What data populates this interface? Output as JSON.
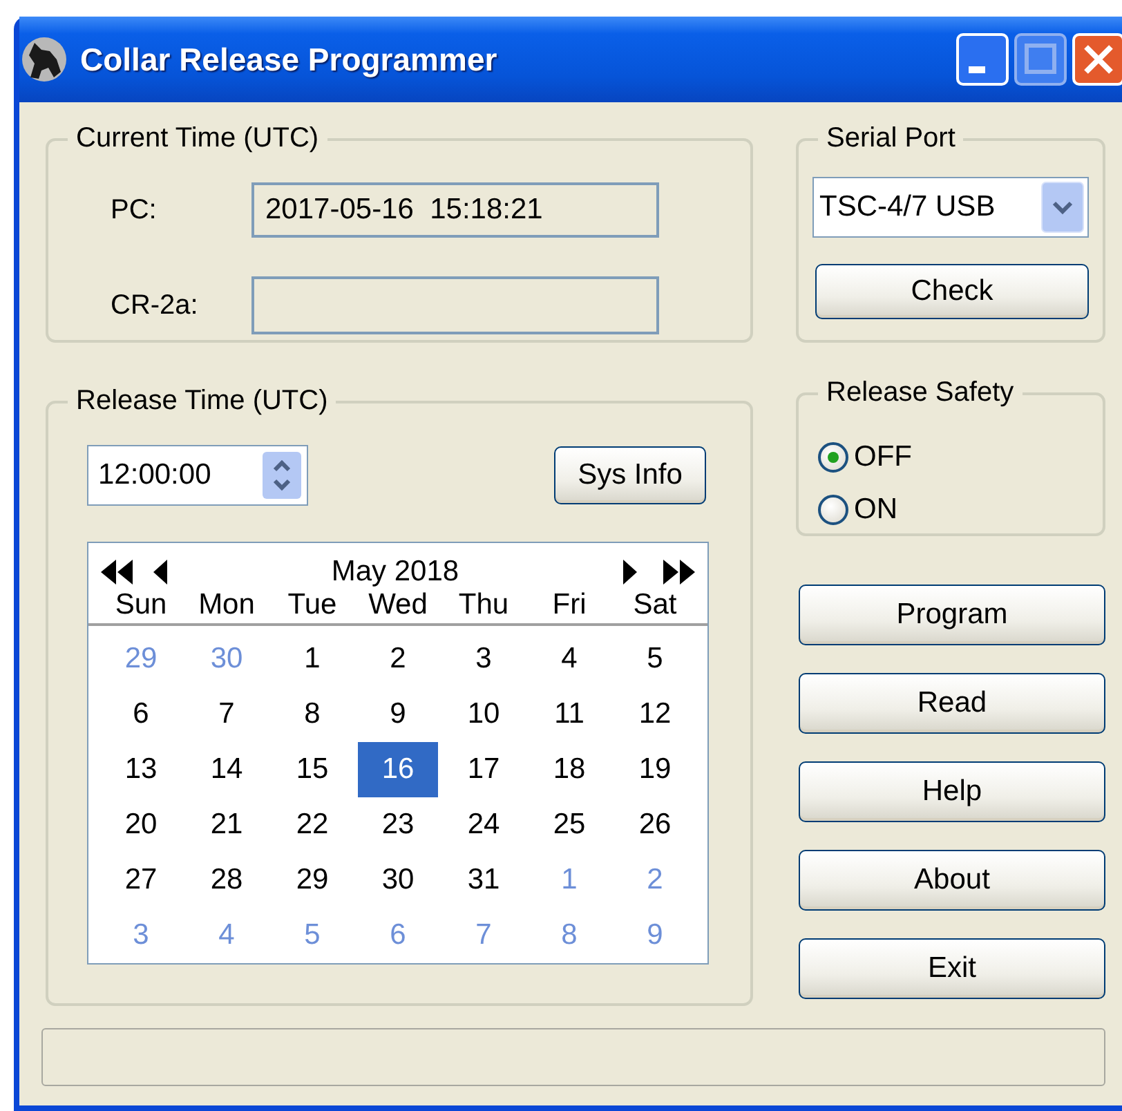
{
  "window": {
    "title": "Collar Release Programmer"
  },
  "current_time": {
    "legend": "Current Time (UTC)",
    "fields": [
      {
        "label": "PC:",
        "value": "2017-05-16  15:18:21"
      },
      {
        "label": "CR-2a:"
      }
    ]
  },
  "serial_port": {
    "legend": "Serial Port",
    "value": "TSC-4/7 USB",
    "button": "Check"
  },
  "release_time": {
    "legend": "Release Time (UTC)",
    "time": "12:00:00",
    "button": "Sys Info",
    "calendar": {
      "month": "May 2018",
      "weekdays": [
        "Sun",
        "Mon",
        "Tue",
        "Wed",
        "Thu",
        "Fri",
        "Sat"
      ],
      "weeks": [
        [
          {
            "day": "29",
            "other_month": true,
            "selected": false
          },
          {
            "day": "30",
            "other_month": true,
            "selected": false
          },
          {
            "day": "1",
            "other_month": false,
            "selected": false
          },
          {
            "day": "2",
            "other_month": false,
            "selected": false
          },
          {
            "day": "3",
            "other_month": false,
            "selected": false
          },
          {
            "day": "4",
            "other_month": false,
            "selected": false
          },
          {
            "day": "5",
            "other_month": false,
            "selected": false
          }
        ],
        [
          {
            "day": "6",
            "other_month": false,
            "selected": false
          },
          {
            "day": "7",
            "other_month": false,
            "selected": false
          },
          {
            "day": "8",
            "other_month": false,
            "selected": false
          },
          {
            "day": "9",
            "other_month": false,
            "selected": false
          },
          {
            "day": "10",
            "other_month": false,
            "selected": false
          },
          {
            "day": "11",
            "other_month": false,
            "selected": false
          },
          {
            "day": "12",
            "other_month": false,
            "selected": false
          }
        ],
        [
          {
            "day": "13",
            "other_month": false,
            "selected": false
          },
          {
            "day": "14",
            "other_month": false,
            "selected": false
          },
          {
            "day": "15",
            "other_month": false,
            "selected": false
          },
          {
            "day": "16",
            "other_month": false,
            "selected": true
          },
          {
            "day": "17",
            "other_month": false,
            "selected": false
          },
          {
            "day": "18",
            "other_month": false,
            "selected": false
          },
          {
            "day": "19",
            "other_month": false,
            "selected": false
          }
        ],
        [
          {
            "day": "20",
            "other_month": false,
            "selected": false
          },
          {
            "day": "21",
            "other_month": false,
            "selected": false
          },
          {
            "day": "22",
            "other_month": false,
            "selected": false
          },
          {
            "day": "23",
            "other_month": false,
            "selected": false
          },
          {
            "day": "24",
            "other_month": false,
            "selected": false
          },
          {
            "day": "25",
            "other_month": false,
            "selected": false
          },
          {
            "day": "26",
            "other_month": false,
            "selected": false
          }
        ],
        [
          {
            "day": "27",
            "other_month": false,
            "selected": false
          },
          {
            "day": "28",
            "other_month": false,
            "selected": false
          },
          {
            "day": "29",
            "other_month": false,
            "selected": false
          },
          {
            "day": "30",
            "other_month": false,
            "selected": false
          },
          {
            "day": "31",
            "other_month": false,
            "selected": false
          },
          {
            "day": "1",
            "other_month": true,
            "selected": false
          },
          {
            "day": "2",
            "other_month": true,
            "selected": false
          }
        ],
        [
          {
            "day": "3",
            "other_month": true,
            "selected": false
          },
          {
            "day": "4",
            "other_month": true,
            "selected": false
          },
          {
            "day": "5",
            "other_month": true,
            "selected": false
          },
          {
            "day": "6",
            "other_month": true,
            "selected": false
          },
          {
            "day": "7",
            "other_month": true,
            "selected": false
          },
          {
            "day": "8",
            "other_month": true,
            "selected": false
          },
          {
            "day": "9",
            "other_month": true,
            "selected": false
          }
        ]
      ]
    }
  },
  "release_safety": {
    "legend": "Release Safety",
    "options": [
      {
        "label": "OFF",
        "selected": true
      },
      {
        "label": "ON",
        "selected": false
      }
    ]
  },
  "buttons": [
    "Program",
    "Read",
    "Help",
    "About",
    "Exit"
  ]
}
